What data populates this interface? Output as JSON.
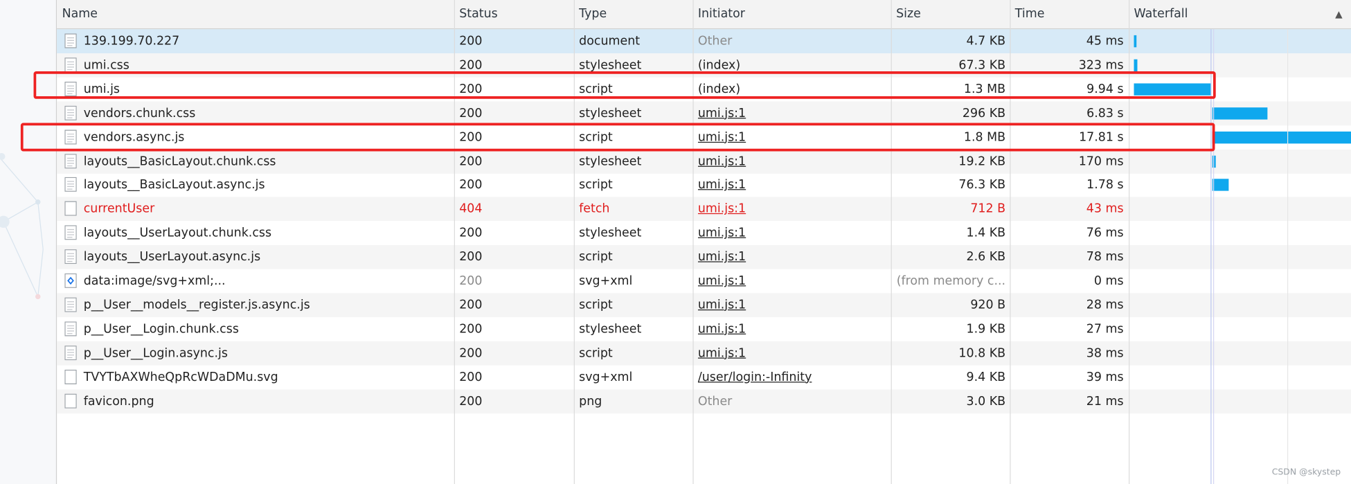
{
  "columns": {
    "name": "Name",
    "status": "Status",
    "type": "Type",
    "initiator": "Initiator",
    "size": "Size",
    "time": "Time",
    "waterfall": "Waterfall",
    "sort_indicator": "▲"
  },
  "rows": [
    {
      "name": "139.199.70.227",
      "status": "200",
      "type": "document",
      "initiator": "Other",
      "size": "4.7 KB",
      "time": "45 ms",
      "icon": "document-icon"
    },
    {
      "name": "umi.css",
      "status": "200",
      "type": "stylesheet",
      "initiator": "(index)",
      "size": "67.3 KB",
      "time": "323 ms",
      "icon": "file-icon"
    },
    {
      "name": "umi.js",
      "status": "200",
      "type": "script",
      "initiator": "(index)",
      "size": "1.3 MB",
      "time": "9.94 s",
      "icon": "file-icon"
    },
    {
      "name": "vendors.chunk.css",
      "status": "200",
      "type": "stylesheet",
      "initiator": "umi.js:1",
      "size": "296 KB",
      "time": "6.83 s",
      "icon": "file-icon"
    },
    {
      "name": "vendors.async.js",
      "status": "200",
      "type": "script",
      "initiator": "umi.js:1",
      "size": "1.8 MB",
      "time": "17.81 s",
      "icon": "file-icon"
    },
    {
      "name": "layouts__BasicLayout.chunk.css",
      "status": "200",
      "type": "stylesheet",
      "initiator": "umi.js:1",
      "size": "19.2 KB",
      "time": "170 ms",
      "icon": "file-icon"
    },
    {
      "name": "layouts__BasicLayout.async.js",
      "status": "200",
      "type": "script",
      "initiator": "umi.js:1",
      "size": "76.3 KB",
      "time": "1.78 s",
      "icon": "file-icon"
    },
    {
      "name": "currentUser",
      "status": "404",
      "type": "fetch",
      "initiator": "umi.js:1",
      "size": "712 B",
      "time": "43 ms",
      "icon": "blank-file-icon"
    },
    {
      "name": "layouts__UserLayout.chunk.css",
      "status": "200",
      "type": "stylesheet",
      "initiator": "umi.js:1",
      "size": "1.4 KB",
      "time": "76 ms",
      "icon": "file-icon"
    },
    {
      "name": "layouts__UserLayout.async.js",
      "status": "200",
      "type": "script",
      "initiator": "umi.js:1",
      "size": "2.6 KB",
      "time": "78 ms",
      "icon": "file-icon"
    },
    {
      "name": "data:image/svg+xml;...",
      "status": "200",
      "type": "svg+xml",
      "initiator": "umi.js:1",
      "size": "(from memory c...",
      "time": "0 ms",
      "icon": "svg-image-icon"
    },
    {
      "name": "p__User__models__register.js.async.js",
      "status": "200",
      "type": "script",
      "initiator": "umi.js:1",
      "size": "920 B",
      "time": "28 ms",
      "icon": "file-icon"
    },
    {
      "name": "p__User__Login.chunk.css",
      "status": "200",
      "type": "stylesheet",
      "initiator": "umi.js:1",
      "size": "1.9 KB",
      "time": "27 ms",
      "icon": "file-icon"
    },
    {
      "name": "p__User__Login.async.js",
      "status": "200",
      "type": "script",
      "initiator": "umi.js:1",
      "size": "10.8 KB",
      "time": "38 ms",
      "icon": "file-icon"
    },
    {
      "name": "TVYTbAXWheQpRcWDaDMu.svg",
      "status": "200",
      "type": "svg+xml",
      "initiator": "/user/login:-Infinity",
      "size": "9.4 KB",
      "time": "39 ms",
      "icon": "blank-file-icon"
    },
    {
      "name": "favicon.png",
      "status": "200",
      "type": "png",
      "initiator": "Other",
      "size": "3.0 KB",
      "time": "21 ms",
      "icon": "blank-file-icon"
    }
  ],
  "waterfall_bar_color": "#0fa8ee",
  "highlight_color": "#ee2222",
  "error_color": "#e01d1d",
  "watermark": "CSDN @skystep"
}
